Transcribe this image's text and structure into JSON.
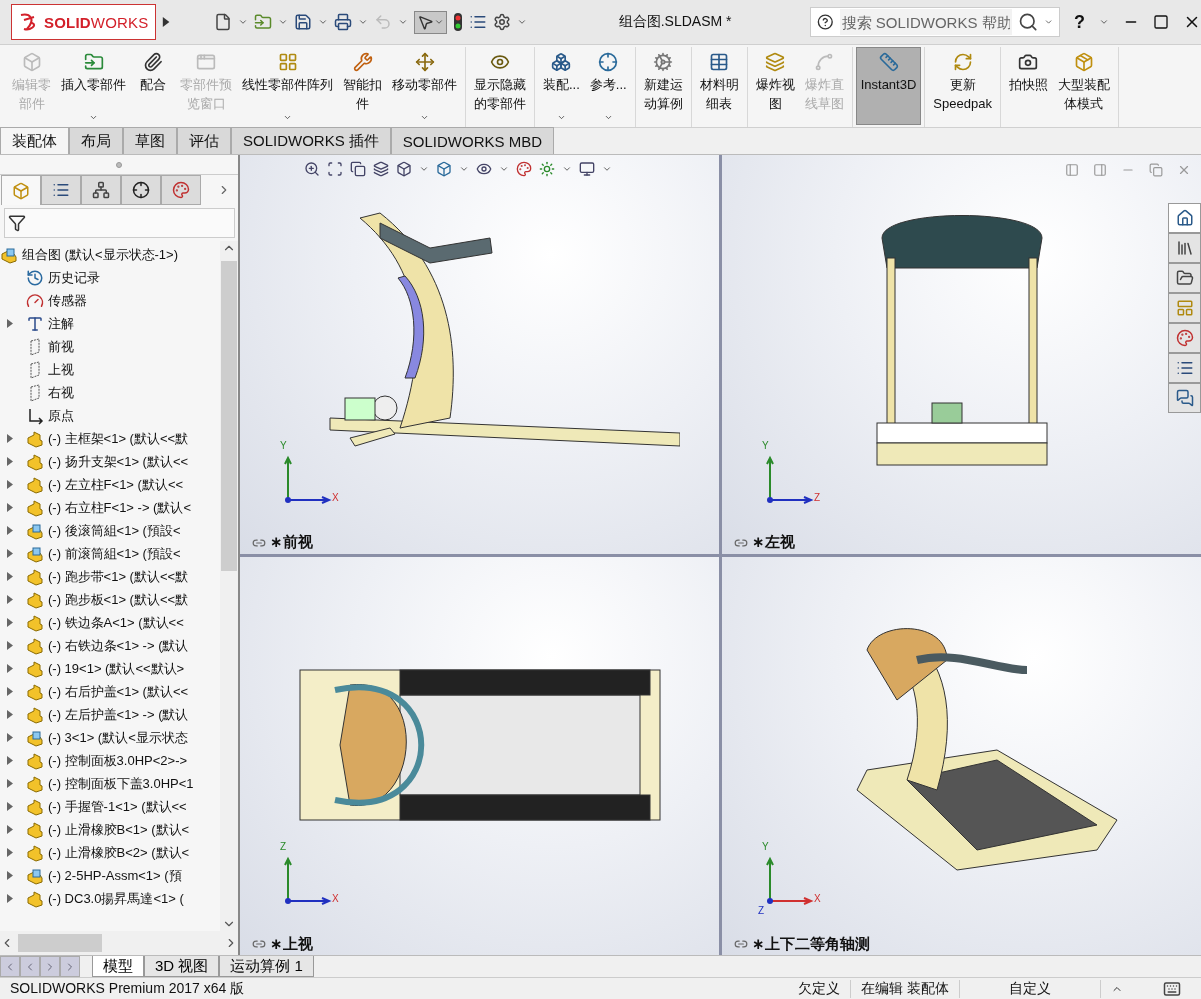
{
  "app": {
    "logo": "**SOLID**WORKS",
    "title": "组合图.SLDASM *",
    "search": {
      "placeholder": "搜索 SOLIDWORKS 帮助"
    },
    "help": "?"
  },
  "ribbon": {
    "groups": [
      {
        "buttons": [
          {
            "lines": [
              "编辑零",
              "部件"
            ],
            "disabled": true,
            "selected": false,
            "dropdown": false
          },
          {
            "lines": [
              "插入零部件"
            ],
            "disabled": false,
            "selected": false,
            "dropdown": true
          },
          {
            "lines": [
              "配合"
            ],
            "disabled": false,
            "selected": false,
            "dropdown": false
          },
          {
            "lines": [
              "零部件预",
              "览窗口"
            ],
            "disabled": true,
            "selected": false,
            "dropdown": false
          },
          {
            "lines": [
              "线性零部件阵列"
            ],
            "disabled": false,
            "selected": false,
            "dropdown": true
          },
          {
            "lines": [
              "智能扣",
              "件"
            ],
            "disabled": false,
            "selected": false,
            "dropdown": false
          },
          {
            "lines": [
              "移动零部件"
            ],
            "disabled": false,
            "selected": false,
            "dropdown": true
          }
        ]
      },
      {
        "buttons": [
          {
            "lines": [
              "显示隐藏",
              "的零部件"
            ],
            "disabled": false,
            "selected": false,
            "dropdown": false
          }
        ]
      },
      {
        "buttons": [
          {
            "lines": [
              "装配..."
            ],
            "disabled": false,
            "selected": false,
            "dropdown": true
          },
          {
            "lines": [
              "参考..."
            ],
            "disabled": false,
            "selected": false,
            "dropdown": true
          }
        ]
      },
      {
        "buttons": [
          {
            "lines": [
              "新建运",
              "动算例"
            ],
            "disabled": false,
            "selected": false,
            "dropdown": false
          }
        ]
      },
      {
        "buttons": [
          {
            "lines": [
              "材料明",
              "细表"
            ],
            "disabled": false,
            "selected": false,
            "dropdown": false
          }
        ]
      },
      {
        "buttons": [
          {
            "lines": [
              "爆炸视",
              "图"
            ],
            "disabled": false,
            "selected": false,
            "dropdown": false
          },
          {
            "lines": [
              "爆炸直",
              "线草图"
            ],
            "disabled": true,
            "selected": false,
            "dropdown": false
          }
        ]
      },
      {
        "buttons": [
          {
            "lines": [
              "Instant3D"
            ],
            "disabled": false,
            "selected": true,
            "dropdown": false
          }
        ]
      },
      {
        "buttons": [
          {
            "lines": [
              "更新",
              "Speedpak"
            ],
            "disabled": false,
            "selected": false,
            "dropdown": false
          }
        ]
      },
      {
        "buttons": [
          {
            "lines": [
              "拍快照"
            ],
            "disabled": false,
            "selected": false,
            "dropdown": false
          },
          {
            "lines": [
              "大型装配",
              "体模式"
            ],
            "disabled": false,
            "selected": false,
            "dropdown": false
          }
        ]
      }
    ]
  },
  "tabs": [
    {
      "label": "装配体",
      "selected": true
    },
    {
      "label": "布局",
      "selected": false
    },
    {
      "label": "草图",
      "selected": false
    },
    {
      "label": "评估",
      "selected": false
    },
    {
      "label": "SOLIDWORKS 插件",
      "selected": false
    },
    {
      "label": "SOLIDWORKS MBD",
      "selected": false
    }
  ],
  "feature_tree": {
    "panel_tabs": [
      {
        "selected": true
      },
      {
        "selected": false
      },
      {
        "selected": false
      },
      {
        "selected": false
      },
      {
        "selected": false
      }
    ],
    "root": {
      "label": "组合图  (默认<显示状态-1>)",
      "children": [
        {
          "label": "历史记录",
          "kind": "history",
          "expander": false
        },
        {
          "label": "传感器",
          "kind": "sensor",
          "expander": false
        },
        {
          "label": "注解",
          "kind": "annotation",
          "expander": true
        },
        {
          "label": "前视",
          "kind": "plane",
          "expander": false
        },
        {
          "label": "上视",
          "kind": "plane",
          "expander": false
        },
        {
          "label": "右视",
          "kind": "plane",
          "expander": false
        },
        {
          "label": "原点",
          "kind": "origin",
          "expander": false
        },
        {
          "label": "(-) 主框架<1> (默认<<默",
          "kind": "part",
          "expander": true
        },
        {
          "label": "(-) 扬升支架<1> (默认<<",
          "kind": "part",
          "expander": true
        },
        {
          "label": "(-) 左立柱F<1> (默认<<",
          "kind": "part",
          "expander": true
        },
        {
          "label": "(-) 右立柱F<1> -> (默认<",
          "kind": "part",
          "expander": true
        },
        {
          "label": "(-) 後滚筒組<1> (預設<",
          "kind": "assembly",
          "expander": true
        },
        {
          "label": "(-) 前滚筒組<1> (預設<",
          "kind": "assembly",
          "expander": true
        },
        {
          "label": "(-) 跑步带<1> (默认<<默",
          "kind": "part",
          "expander": true
        },
        {
          "label": "(-) 跑步板<1> (默认<<默",
          "kind": "part",
          "expander": true
        },
        {
          "label": "(-) 铁边条A<1> (默认<<",
          "kind": "part",
          "expander": true
        },
        {
          "label": "(-) 右铁边条<1> -> (默认",
          "kind": "part",
          "expander": true
        },
        {
          "label": "(-) 19<1> (默认<<默认>",
          "kind": "part",
          "expander": true
        },
        {
          "label": "(-) 右后护盖<1> (默认<<",
          "kind": "part",
          "expander": true
        },
        {
          "label": "(-) 左后护盖<1> -> (默认",
          "kind": "part",
          "expander": true
        },
        {
          "label": "(-) 3<1> (默认<显示状态",
          "kind": "assembly",
          "expander": true
        },
        {
          "label": "(-) 控制面板3.0HP<2>->",
          "kind": "part",
          "expander": true
        },
        {
          "label": "(-) 控制面板下盖3.0HP<1",
          "kind": "part",
          "expander": true
        },
        {
          "label": "(-) 手握管-1<1> (默认<<",
          "kind": "part",
          "expander": true
        },
        {
          "label": "(-) 止滑橡胶B<1> (默认<",
          "kind": "part",
          "expander": true
        },
        {
          "label": "(-) 止滑橡胶B<2> (默认<",
          "kind": "part",
          "expander": true
        },
        {
          "label": "(-) 2-5HP-Assm<1> (預",
          "kind": "assembly",
          "expander": true
        },
        {
          "label": "(-) DC3.0揚昇馬達<1> (",
          "kind": "part",
          "expander": true
        }
      ]
    }
  },
  "task_pane": [
    {
      "selected": true
    },
    {
      "selected": false
    },
    {
      "selected": false
    },
    {
      "selected": false
    },
    {
      "selected": false
    },
    {
      "selected": false
    },
    {
      "selected": false
    }
  ],
  "viewports": [
    {
      "label": "∗前视",
      "axes": [
        "Y",
        "X"
      ]
    },
    {
      "label": "∗左视",
      "axes": [
        "Y",
        "Z"
      ]
    },
    {
      "label": "∗上视",
      "axes": [
        "Z",
        "X"
      ]
    },
    {
      "label": "∗上下二等角轴测",
      "axes": [
        "Y",
        "X",
        "Z"
      ]
    }
  ],
  "bottom_tabs": [
    {
      "label": "模型",
      "selected": true
    },
    {
      "label": "3D 视图",
      "selected": false
    },
    {
      "label": "运动算例 1",
      "selected": false
    }
  ],
  "status_bar": {
    "product": "SOLIDWORKS Premium 2017 x64 版",
    "items": [
      "欠定义",
      "在编辑 装配体",
      "自定义"
    ]
  }
}
